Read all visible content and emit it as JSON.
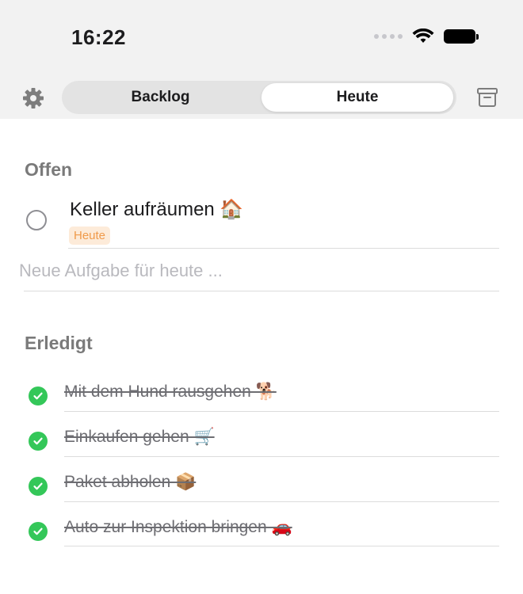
{
  "status_bar": {
    "time": "16:22"
  },
  "toolbar": {
    "segments": [
      {
        "label": "Backlog",
        "selected": false
      },
      {
        "label": "Heute",
        "selected": true
      }
    ]
  },
  "sections": {
    "open": {
      "title": "Offen",
      "items": [
        {
          "title": "Keller aufräumen 🏠",
          "tag": "Heute",
          "done": false
        }
      ],
      "new_task_placeholder": "Neue Aufgabe für heute ..."
    },
    "done": {
      "title": "Erledigt",
      "items": [
        {
          "title": "Mit dem Hund rausgehen 🐕",
          "done": true
        },
        {
          "title": "Einkaufen gehen 🛒",
          "done": true
        },
        {
          "title": "Paket abholen 📦",
          "done": true
        },
        {
          "title": "Auto zur Inspektion bringen 🚗",
          "done": true
        }
      ]
    }
  },
  "colors": {
    "accent_done": "#34c759",
    "tag_text": "#f09a4a",
    "tag_background": "#fdebd9",
    "section_title": "#7a7a7a"
  },
  "icons": {
    "settings": "gear-icon",
    "archive": "archive-icon",
    "wifi": "wifi-icon",
    "battery": "battery-icon",
    "cellular": "cellular-dots-icon"
  }
}
